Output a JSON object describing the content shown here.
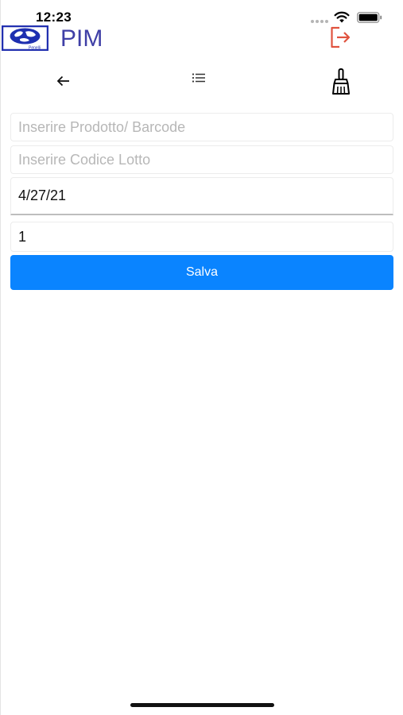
{
  "status_bar": {
    "time": "12:23"
  },
  "header": {
    "title": "PIM",
    "logo_label": "Penelli",
    "accent_color": "#3f3fa6",
    "logout_color": "#e0533f",
    "logout_icon": "logout-icon"
  },
  "toolbar": {
    "back_icon": "arrow-left-icon",
    "list_icon": "list-icon",
    "clear_icon": "broom-icon"
  },
  "form": {
    "product_placeholder": "Inserire Prodotto/ Barcode",
    "product_value": "",
    "lot_placeholder": "Inserire Codice Lotto",
    "lot_value": "",
    "date_value": "4/27/21",
    "quantity_value": "1",
    "save_label": "Salva",
    "save_color": "#0a84ff"
  }
}
